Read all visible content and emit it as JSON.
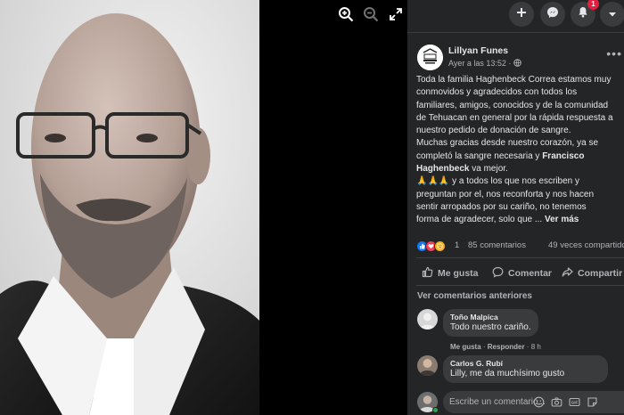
{
  "viewer": {
    "icons": [
      "zoom-in-icon",
      "zoom-out-icon",
      "fullscreen-icon"
    ]
  },
  "topbar": {
    "notification_count": "1",
    "icons": [
      "plus-icon",
      "messenger-icon",
      "bell-icon",
      "caret-down-icon"
    ]
  },
  "post": {
    "author": "Lillyan Funes",
    "time": "Ayer a las 13:52 ·",
    "lines": [
      "Toda la familia Haghenbeck Correa estamos muy",
      "conmovidos y agradecidos con todos los",
      "familiares, amigos, conocidos y de la comunidad",
      "de Tehuacan en general por la rápida respuesta a",
      "nuestro pedido de donación de sangre.",
      "Muchas gracias desde nuestro corazón, ya se",
      "completó la sangre necesaria y "
    ],
    "bold_name_1": "Francisco",
    "bold_name_2": "Haghenbeck",
    "line_after_name": " va mejor.",
    "emoji_line": "🙏🙏🙏 y a todos los que nos escriben y",
    "lines_after": [
      "preguntan por el, nos reconforta y nos hacen",
      "sentir arropados por su cariño, no tenemos",
      "forma de agradecer, solo que ..."
    ],
    "see_more": " Ver más"
  },
  "stats": {
    "reactions": "1",
    "comments": "85 comentarios",
    "shares": "49 veces compartido"
  },
  "actions": {
    "like": "Me gusta",
    "comment": "Comentar",
    "share": "Compartir"
  },
  "comments": {
    "previous_label": "Ver comentarios anteriores",
    "items": [
      {
        "name": "Toño Malpica",
        "text": "Todo nuestro cariño."
      },
      {
        "name": "Carlos G. Rubí",
        "text": "Lilly, me da muchísimo gusto"
      }
    ],
    "meta": {
      "like": "Me gusta",
      "sep": " · ",
      "reply": "Responder",
      "time": " · 8 h"
    }
  },
  "composer": {
    "placeholder": "Escribe un comentario..."
  },
  "colors": {
    "panel_bg": "#242526",
    "bubble_bg": "#3a3b3c",
    "like_blue": "#1877f2",
    "badge_red": "#e41e3f"
  }
}
